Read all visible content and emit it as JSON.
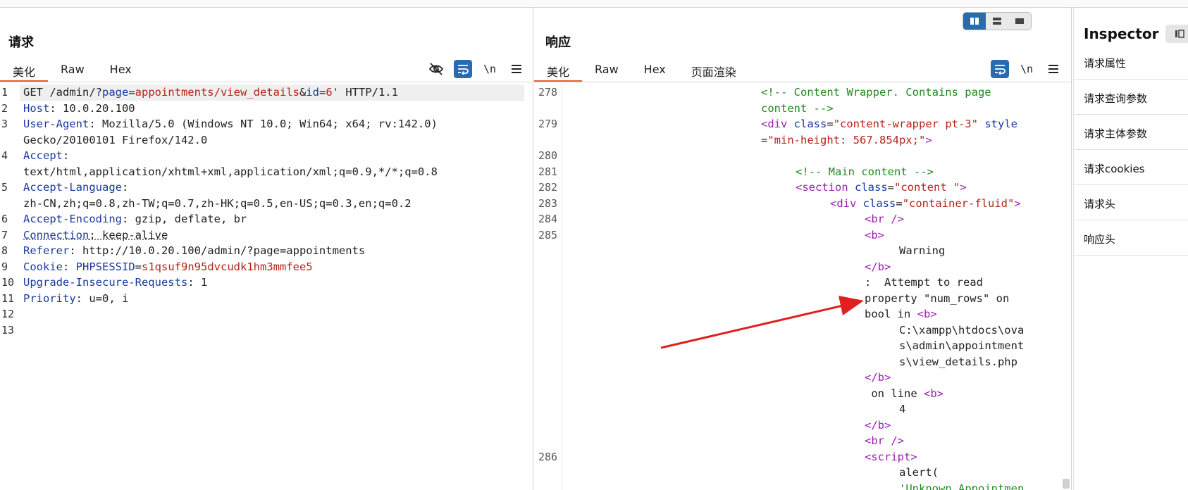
{
  "request": {
    "title": "请求",
    "tabs": [
      "美化",
      "Raw",
      "Hex"
    ],
    "toolbar_icons": [
      "eye-slash-icon",
      "wrap-icon",
      "newline-icon",
      "menu-icon"
    ],
    "newline_label": "\\n",
    "lines": [
      {
        "n": "1",
        "parts": [
          {
            "c": "v",
            "t": "GET /admin/?"
          },
          {
            "c": "k",
            "t": "page"
          },
          {
            "c": "v",
            "t": "="
          },
          {
            "c": "r",
            "t": "appointments/view_details"
          },
          {
            "c": "v",
            "t": "&"
          },
          {
            "c": "k",
            "t": "id"
          },
          {
            "c": "v",
            "t": "="
          },
          {
            "c": "r",
            "t": "6'"
          },
          {
            "c": "v",
            "t": " HTTP/1.1"
          }
        ]
      },
      {
        "n": "2",
        "parts": [
          {
            "c": "k",
            "t": "Host"
          },
          {
            "c": "v",
            "t": ": 10.0.20.100"
          }
        ]
      },
      {
        "n": "3",
        "parts": [
          {
            "c": "k",
            "t": "User-Agent"
          },
          {
            "c": "v",
            "t": ": Mozilla/5.0 (Windows NT 10.0; Win64; x64; rv:142.0)"
          }
        ]
      },
      {
        "n": "",
        "parts": [
          {
            "c": "v",
            "t": "Gecko/20100101 Firefox/142.0"
          }
        ]
      },
      {
        "n": "4",
        "parts": [
          {
            "c": "k",
            "t": "Accept"
          },
          {
            "c": "v",
            "t": ":"
          }
        ]
      },
      {
        "n": "",
        "parts": [
          {
            "c": "v",
            "t": "text/html,application/xhtml+xml,application/xml;q=0.9,*/*;q=0.8"
          }
        ]
      },
      {
        "n": "5",
        "parts": [
          {
            "c": "k",
            "t": "Accept-Language"
          },
          {
            "c": "v",
            "t": ":"
          }
        ]
      },
      {
        "n": "",
        "parts": [
          {
            "c": "v",
            "t": "zh-CN,zh;q=0.8,zh-TW;q=0.7,zh-HK;q=0.5,en-US;q=0.3,en;q=0.2"
          }
        ]
      },
      {
        "n": "6",
        "parts": [
          {
            "c": "k",
            "t": "Accept-Encoding"
          },
          {
            "c": "v",
            "t": ": gzip, deflate, br"
          }
        ]
      },
      {
        "n": "7",
        "parts": [
          {
            "c": "k u",
            "t": "Connection"
          },
          {
            "c": "v u",
            "t": ": keep-alive"
          }
        ]
      },
      {
        "n": "8",
        "parts": [
          {
            "c": "k",
            "t": "Referer"
          },
          {
            "c": "v",
            "t": ": http://10.0.20.100/admin/?page=appointments"
          }
        ]
      },
      {
        "n": "9",
        "parts": [
          {
            "c": "k",
            "t": "Cookie"
          },
          {
            "c": "v",
            "t": ": "
          },
          {
            "c": "k",
            "t": "PHPSESSID"
          },
          {
            "c": "v",
            "t": "="
          },
          {
            "c": "r",
            "t": "s1qsuf9n95dvcudk1hm3mmfee5"
          }
        ]
      },
      {
        "n": "10",
        "parts": [
          {
            "c": "k",
            "t": "Upgrade-Insecure-Requests"
          },
          {
            "c": "v",
            "t": ": 1"
          }
        ]
      },
      {
        "n": "11",
        "parts": [
          {
            "c": "k",
            "t": "Priority"
          },
          {
            "c": "v",
            "t": ": u=0, i"
          }
        ]
      },
      {
        "n": "12",
        "parts": []
      },
      {
        "n": "13",
        "parts": []
      }
    ]
  },
  "response": {
    "title": "响应",
    "tabs": [
      "美化",
      "Raw",
      "Hex",
      "页面渲染"
    ],
    "toolbar_icons": [
      "wrap-icon",
      "newline-icon",
      "menu-icon"
    ],
    "newline_label": "\\n",
    "lines": [
      {
        "n": "278",
        "ind": 0,
        "parts": [
          {
            "c": "cm",
            "t": "<!-- Content Wrapper. Contains page"
          }
        ]
      },
      {
        "n": "",
        "ind": 0,
        "parts": [
          {
            "c": "cm",
            "t": "content -->"
          }
        ]
      },
      {
        "n": "279",
        "ind": 0,
        "parts": [
          {
            "c": "tg",
            "t": "<div "
          },
          {
            "c": "at",
            "t": "class"
          },
          {
            "c": "tx",
            "t": "="
          },
          {
            "c": "sv",
            "t": "\"content-wrapper pt-3\""
          },
          {
            "c": "at",
            "t": " style"
          }
        ]
      },
      {
        "n": "",
        "ind": 0,
        "parts": [
          {
            "c": "tx",
            "t": "="
          },
          {
            "c": "sv",
            "t": "\"min-height: 567.854px;\""
          },
          {
            "c": "tg",
            "t": ">"
          }
        ]
      },
      {
        "n": "280",
        "ind": 0,
        "parts": []
      },
      {
        "n": "281",
        "ind": 1,
        "parts": [
          {
            "c": "cm",
            "t": "<!-- Main content -->"
          }
        ]
      },
      {
        "n": "282",
        "ind": 1,
        "parts": [
          {
            "c": "tg",
            "t": "<section "
          },
          {
            "c": "at",
            "t": "class"
          },
          {
            "c": "tx",
            "t": "="
          },
          {
            "c": "sv",
            "t": "\"content \""
          },
          {
            "c": "tg",
            "t": ">"
          }
        ]
      },
      {
        "n": "283",
        "ind": 2,
        "parts": [
          {
            "c": "tg",
            "t": "<div "
          },
          {
            "c": "at",
            "t": "class"
          },
          {
            "c": "tx",
            "t": "="
          },
          {
            "c": "sv",
            "t": "\"container-fluid\""
          },
          {
            "c": "tg",
            "t": ">"
          }
        ]
      },
      {
        "n": "284",
        "ind": 3,
        "parts": [
          {
            "c": "tg",
            "t": "<br />"
          }
        ]
      },
      {
        "n": "285",
        "ind": 3,
        "parts": [
          {
            "c": "tg",
            "t": "<b>"
          }
        ]
      },
      {
        "n": "",
        "ind": 4,
        "parts": [
          {
            "c": "tx",
            "t": "Warning"
          }
        ]
      },
      {
        "n": "",
        "ind": 3,
        "parts": [
          {
            "c": "tg",
            "t": "</b>"
          }
        ]
      },
      {
        "n": "",
        "ind": 3,
        "parts": [
          {
            "c": "tx",
            "t": ":  Attempt to read"
          }
        ]
      },
      {
        "n": "",
        "ind": 3,
        "parts": [
          {
            "c": "tx",
            "t": "property \"num_rows\" on"
          }
        ]
      },
      {
        "n": "",
        "ind": 3,
        "parts": [
          {
            "c": "tx",
            "t": "bool in "
          },
          {
            "c": "tg",
            "t": "<b>"
          }
        ]
      },
      {
        "n": "",
        "ind": 4,
        "parts": [
          {
            "c": "tx",
            "t": "C:\\xampp\\htdocs\\ova"
          }
        ]
      },
      {
        "n": "",
        "ind": 4,
        "parts": [
          {
            "c": "tx",
            "t": "s\\admin\\appointment"
          }
        ]
      },
      {
        "n": "",
        "ind": 4,
        "parts": [
          {
            "c": "tx",
            "t": "s\\view_details.php"
          }
        ]
      },
      {
        "n": "",
        "ind": 3,
        "parts": [
          {
            "c": "tg",
            "t": "</b>"
          }
        ]
      },
      {
        "n": "",
        "ind": 3,
        "parts": [
          {
            "c": "tx",
            "t": " on line "
          },
          {
            "c": "tg",
            "t": "<b>"
          }
        ]
      },
      {
        "n": "",
        "ind": 4,
        "parts": [
          {
            "c": "tx",
            "t": "4"
          }
        ]
      },
      {
        "n": "",
        "ind": 3,
        "parts": [
          {
            "c": "tg",
            "t": "</b>"
          }
        ]
      },
      {
        "n": "",
        "ind": 3,
        "parts": [
          {
            "c": "tg",
            "t": "<br />"
          }
        ]
      },
      {
        "n": "286",
        "ind": 3,
        "parts": [
          {
            "c": "tg",
            "t": "<script>"
          }
        ]
      },
      {
        "n": "",
        "ind": 4,
        "parts": [
          {
            "c": "tx",
            "t": "alert("
          }
        ]
      },
      {
        "n": "",
        "ind": 4,
        "parts": [
          {
            "c": "st",
            "t": "'Unknown Appointmen"
          }
        ]
      }
    ]
  },
  "inspector": {
    "title": "Inspector",
    "items": [
      "请求属性",
      "请求查询参数",
      "请求主体参数",
      "请求cookies",
      "请求头",
      "响应头"
    ]
  },
  "colors": {
    "accent_tab": "#e8612c",
    "toolbar_blue": "#2a6bb0",
    "annotation_arrow": "#e02020"
  }
}
